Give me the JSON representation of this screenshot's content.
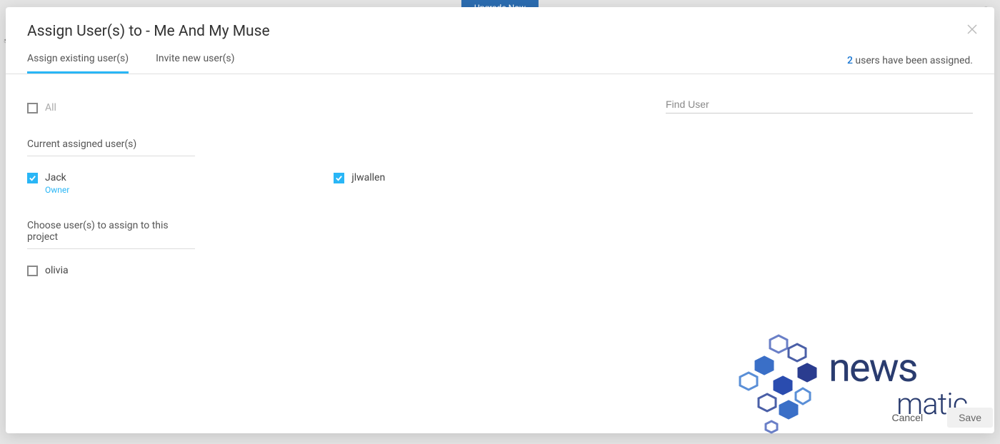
{
  "backdrop": {
    "banner": "Upgrade Now"
  },
  "modal": {
    "title_prefix": "Assign User(s) to - ",
    "title_target": "Me And My Muse",
    "tabs": [
      {
        "label": "Assign existing user(s)",
        "active": true
      },
      {
        "label": "Invite new user(s)",
        "active": false
      }
    ],
    "assigned_count": "2",
    "assigned_suffix": " users have been assigned.",
    "all_label": "All",
    "find_placeholder": "Find User",
    "current_header": "Current assigned user(s)",
    "assigned_users": [
      {
        "name": "Jack",
        "role": "Owner",
        "checked": true
      },
      {
        "name": "jlwallen",
        "role": "",
        "checked": true
      }
    ],
    "choose_header": "Choose user(s) to assign to this project",
    "available_users": [
      {
        "name": "olivia",
        "checked": false
      }
    ],
    "footer": {
      "cancel": "Cancel",
      "save": "Save"
    }
  },
  "watermark": {
    "top": "news",
    "bottom": "matic"
  }
}
